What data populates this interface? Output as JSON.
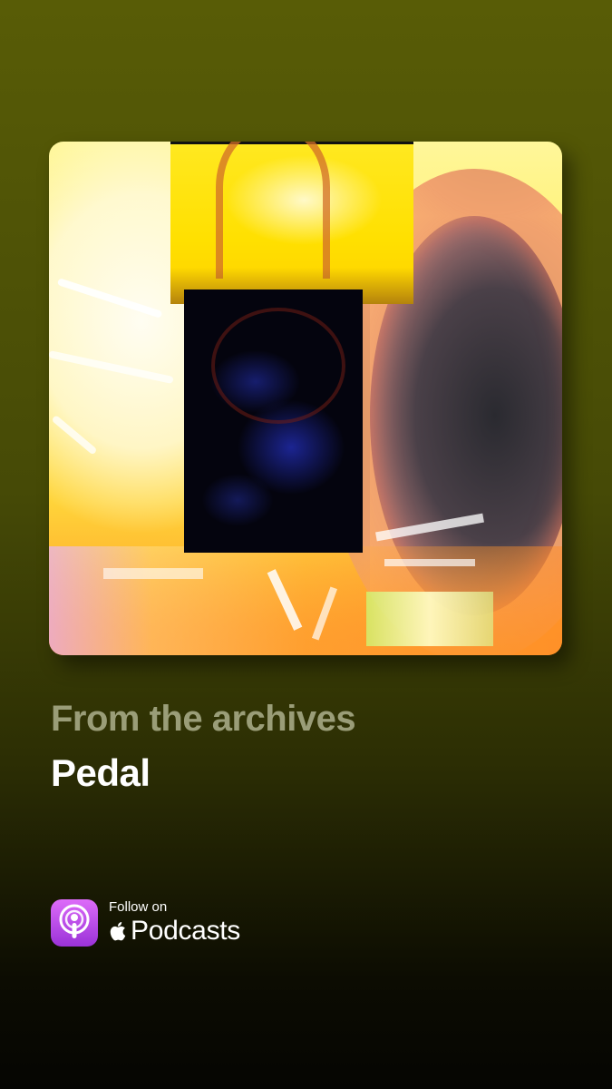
{
  "artwork": {
    "alt_label": "",
    "description": ""
  },
  "episode": {
    "subtitle": "From the archives",
    "title": "Pedal"
  },
  "follow_badge": {
    "prefix": "Follow on",
    "brand": "Podcasts",
    "icons": [
      "podcasts-app-icon",
      "apple-logo-icon"
    ]
  },
  "colors": {
    "background_top": "#585c06",
    "background_bottom": "#050502",
    "subtitle": "#9a9d78",
    "title": "#ffffff",
    "podcast_icon_top": "#dd6cf9",
    "podcast_icon_bottom": "#9a32d8"
  }
}
